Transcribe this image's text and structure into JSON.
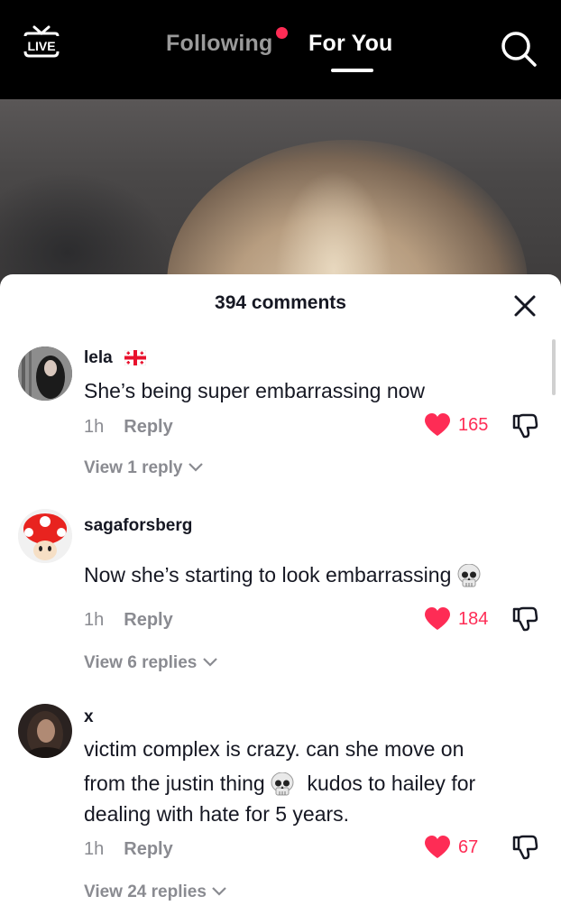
{
  "nav": {
    "live_label": "LIVE",
    "following_label": "Following",
    "foryou_label": "For You"
  },
  "comments_sheet": {
    "title": "394 comments"
  },
  "comments": [
    {
      "username": "lela",
      "flag": "georgia-flag-icon",
      "text": "She’s being super embarrassing now",
      "time": "1h",
      "reply_label": "Reply",
      "likes": "165",
      "view_replies": "View 1 reply"
    },
    {
      "username": "sagaforsberg",
      "text": "Now she’s starting to look embarrassing",
      "text_emoji": "skull-icon",
      "time": "1h",
      "reply_label": "Reply",
      "likes": "184",
      "view_replies": "View 6 replies"
    },
    {
      "username": "x",
      "text_line1": "victim complex is crazy. can she move on",
      "text_line2a": "from the justin thing",
      "text_line2b": "kudos to hailey for",
      "text_line3": "dealing with hate for 5 years.",
      "time": "1h",
      "reply_label": "Reply",
      "likes": "67",
      "view_replies": "View 24 replies"
    }
  ],
  "colors": {
    "accent": "#fe2c55",
    "text": "#161823",
    "muted": "#8a8b91",
    "topbar": "#000000"
  }
}
